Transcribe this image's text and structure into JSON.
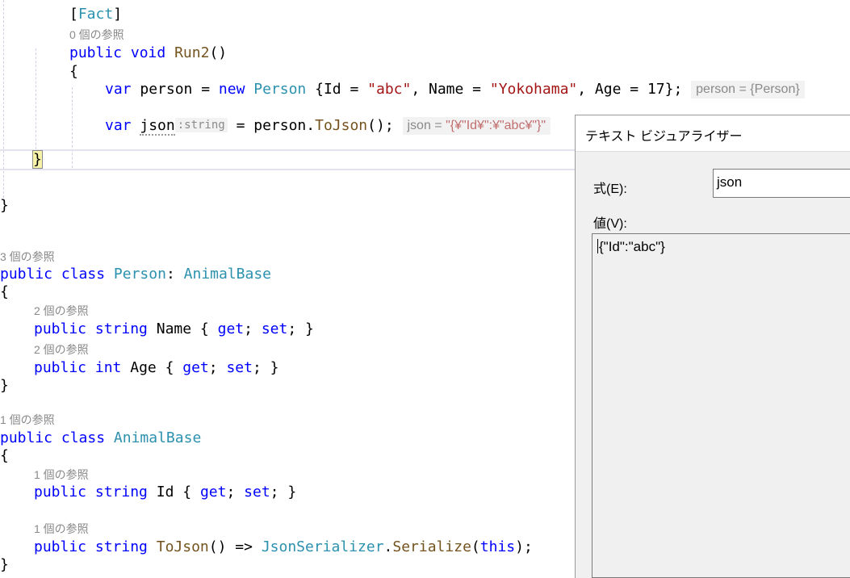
{
  "code": {
    "fact_attr": "Fact",
    "refs_run2": "0 個の参照",
    "run2_kw1": "public",
    "run2_kw2": "void",
    "run2_name": "Run2",
    "run2_paren": "()",
    "brace_open": "{",
    "brace_close": "}",
    "line_person_var": "var",
    "line_person_name": " person = ",
    "line_person_new": "new",
    "line_person_type": "Person",
    "line_person_init1": " {Id = ",
    "line_person_abc": "\"abc\"",
    "line_person_init2": ", Name = ",
    "line_person_yoko": "\"Yokohama\"",
    "line_person_init3": ", Age = 17};",
    "datatip_person": "person = {Person}",
    "line_json_var": "var",
    "line_json_name": "json",
    "line_json_hint": ":string",
    "line_json_rest1": " = person.",
    "line_json_method": "ToJson",
    "line_json_rest2": "();",
    "datatip_json_label": "json = ",
    "datatip_json_value": "\"{¥\"Id¥\":¥\"abc¥\"}\"",
    "refs_person": "3 個の参照",
    "class_kw1": "public",
    "class_kw2": "class",
    "class_person": "Person",
    "colon": ": ",
    "class_animalbase": "AnimalBase",
    "refs_name": "2 個の参照",
    "prop_public": "public",
    "prop_string": "string",
    "prop_int": "int",
    "prop_name": " Name { ",
    "prop_age": " Age { ",
    "prop_id": " Id { ",
    "get": "get",
    "set": "set",
    "semi_space": "; ",
    "semi_close": "; }",
    "refs_age": "2 個の参照",
    "refs_animal": "1 個の参照",
    "refs_id": "1 個の参照",
    "refs_tojson": "1 個の参照",
    "tojson_name": "ToJson",
    "tojson_arrow": "() => ",
    "json_serializer": "JsonSerializer",
    "dot": ".",
    "serialize": "Serialize",
    "open_paren": "(",
    "this_kw": "this",
    "close_semi": ");"
  },
  "visualizer": {
    "title": "テキスト ビジュアライザー",
    "expression_label": "式(E):",
    "expression_value": "json",
    "value_label": "値(V):",
    "value_text": "{\"Id\":\"abc\"}"
  }
}
